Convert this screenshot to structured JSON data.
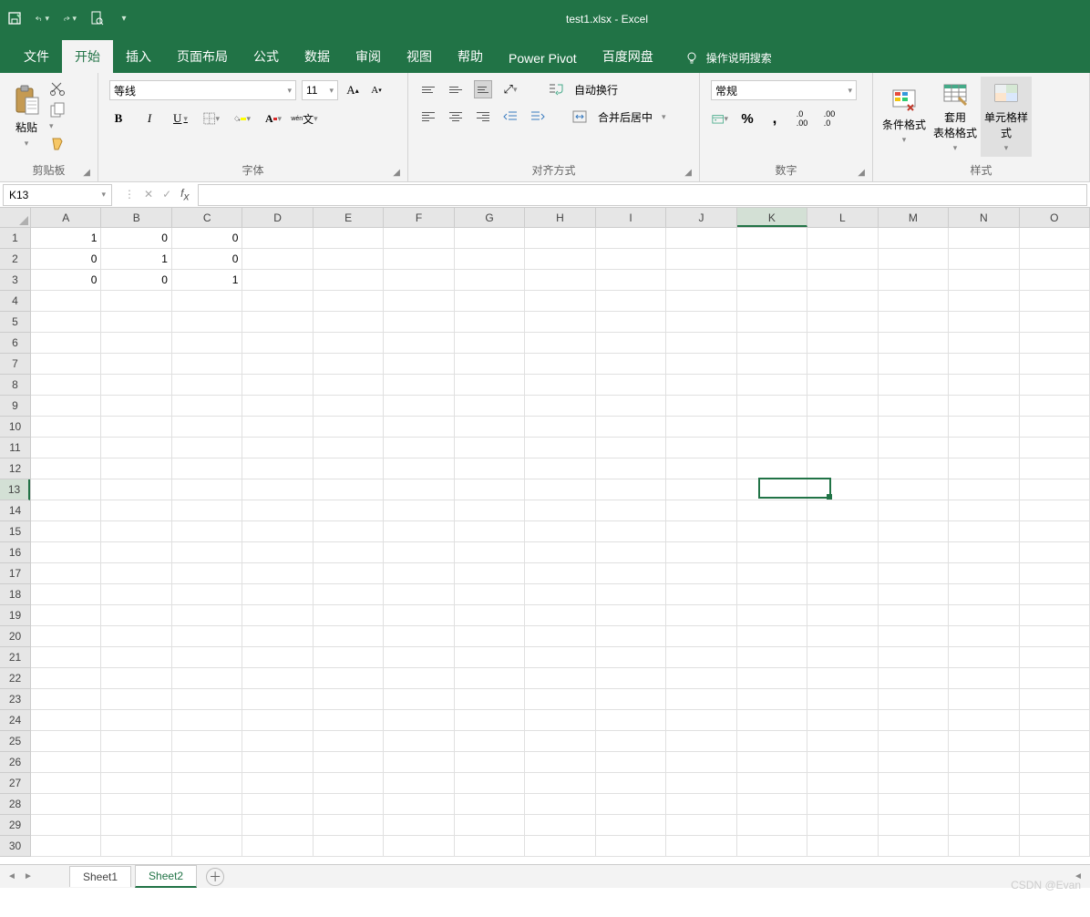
{
  "title": {
    "file": "test1.xlsx",
    "sep": "  -  ",
    "app": "Excel"
  },
  "tabs": [
    "文件",
    "开始",
    "插入",
    "页面布局",
    "公式",
    "数据",
    "审阅",
    "视图",
    "帮助",
    "Power Pivot",
    "百度网盘"
  ],
  "active_tab": 1,
  "tell_me": "操作说明搜索",
  "ribbon": {
    "clipboard": {
      "paste": "粘贴",
      "label": "剪贴板"
    },
    "font": {
      "name": "等线",
      "size": "11",
      "label": "字体",
      "pinyin": "wén"
    },
    "align": {
      "wrap": "自动换行",
      "merge": "合并后居中",
      "label": "对齐方式"
    },
    "number": {
      "format": "常规",
      "label": "数字"
    },
    "styles": {
      "cond": "条件格式",
      "tbl": "套用\n表格格式",
      "cell": "单元格样式",
      "label": "样式"
    }
  },
  "namebox": "K13",
  "columns": [
    "A",
    "B",
    "C",
    "D",
    "E",
    "F",
    "G",
    "H",
    "I",
    "J",
    "K",
    "L",
    "M",
    "N",
    "O"
  ],
  "sel_col": 10,
  "rows": 30,
  "sel_row": 12,
  "cells": {
    "0": [
      "1",
      "0",
      "0"
    ],
    "1": [
      "0",
      "1",
      "0"
    ],
    "2": [
      "0",
      "0",
      "1"
    ]
  },
  "sheets": [
    "Sheet1",
    "Sheet2"
  ],
  "active_sheet": 1,
  "watermark": "CSDN @Evan"
}
